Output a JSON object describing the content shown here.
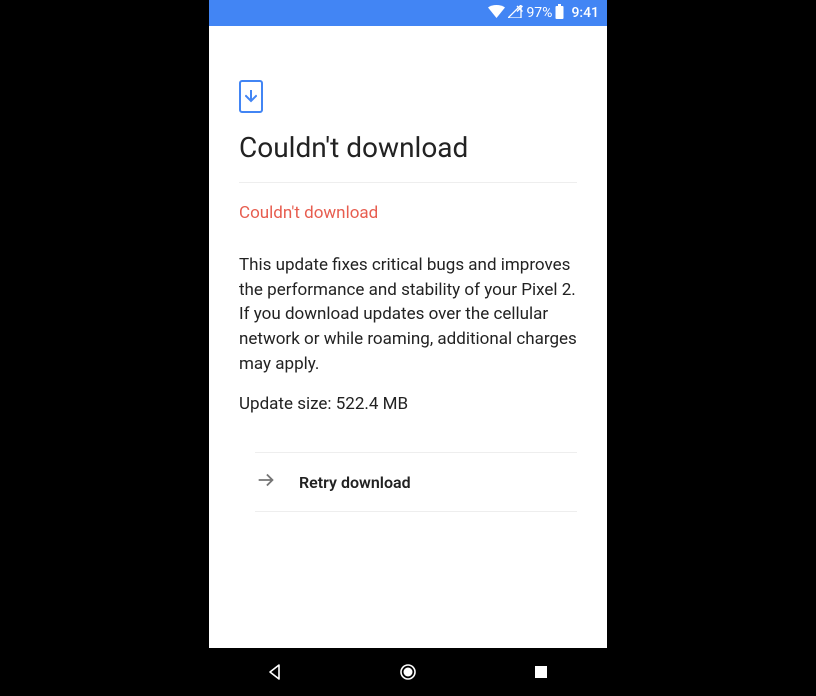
{
  "status_bar": {
    "battery_pct": "97%",
    "time": "9:41"
  },
  "page": {
    "title": "Couldn't download",
    "error": "Couldn't download",
    "description": "This update fixes critical bugs and improves the performance and stability of your Pixel 2. If you download updates over the cellular network or while roaming, additional charges may apply.",
    "update_size": "Update size: 522.4 MB"
  },
  "action": {
    "retry_label": "Retry download"
  }
}
